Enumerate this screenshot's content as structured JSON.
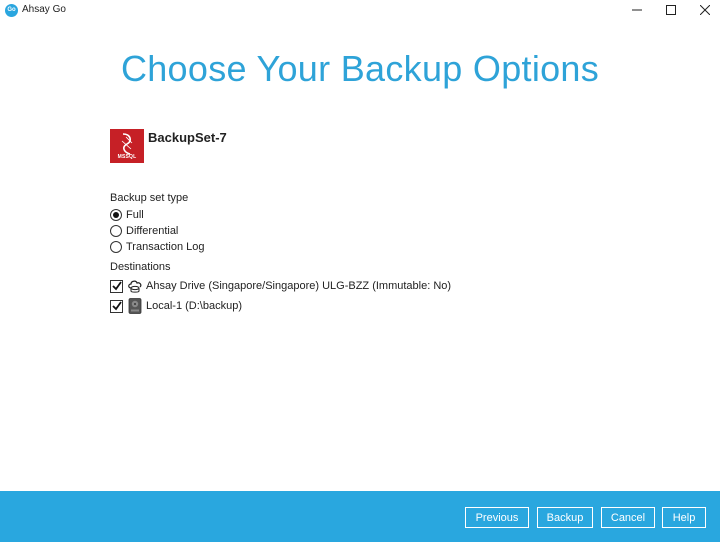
{
  "window": {
    "app_logo_text": "Go",
    "title": "Ahsay Go"
  },
  "page": {
    "heading": "Choose Your Backup Options"
  },
  "backup_set": {
    "name": "BackupSet-7",
    "icon_label": "MSSQL"
  },
  "backup_set_type": {
    "label": "Backup set type",
    "options": [
      {
        "label": "Full",
        "selected": true
      },
      {
        "label": "Differential",
        "selected": false
      },
      {
        "label": "Transaction Log",
        "selected": false
      }
    ]
  },
  "destinations": {
    "label": "Destinations",
    "items": [
      {
        "label": "Ahsay Drive (Singapore/Singapore) ULG-BZZ (Immutable: No)",
        "checked": true,
        "icon": "cloud-drive-icon"
      },
      {
        "label": "Local-1 (D:\\backup)",
        "checked": true,
        "icon": "local-disk-icon"
      }
    ]
  },
  "footer": {
    "previous": "Previous",
    "backup": "Backup",
    "cancel": "Cancel",
    "help": "Help"
  },
  "colors": {
    "accent": "#29a7df",
    "heading": "#2ea3d8",
    "mssql_icon": "#c62026"
  }
}
